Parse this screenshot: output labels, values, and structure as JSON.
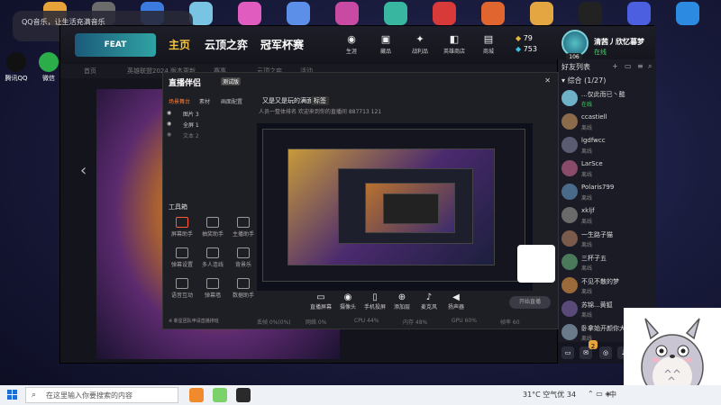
{
  "toast": {
    "text": "QQ音乐，让生活充满音乐"
  },
  "desktop": {
    "icons": [
      {
        "label": "腾讯QQ",
        "color": "#1a1a1a"
      },
      {
        "label": "微信",
        "color": "#2bae4a"
      }
    ]
  },
  "client": {
    "brand": "FEAT",
    "nav": [
      "主页",
      "云顶之弈",
      "冠军杯赛"
    ],
    "top_icons": [
      {
        "label": "生涯",
        "icon": "person-icon"
      },
      {
        "label": "藏品",
        "icon": "collection-icon"
      },
      {
        "label": "战利品",
        "icon": "loot-icon"
      },
      {
        "label": "英雄商店",
        "icon": "store-icon"
      },
      {
        "label": "商城",
        "icon": "shop-icon"
      }
    ],
    "currency": {
      "be": "79",
      "rp": "753"
    },
    "profile": {
      "name": "清茜丿欣忆暮梦",
      "status": "在线",
      "level": "106"
    },
    "subnav": [
      "首页",
      "英雄联盟2024",
      "版本更新",
      "赛事",
      "云顶之弈",
      "活动"
    ],
    "hero_glyph": "光",
    "accent": "#f5c542"
  },
  "friends": {
    "title": "好友列表",
    "group": "综合 (1/27)",
    "list": [
      {
        "name": "...仅此而已丶懿",
        "status": "在线",
        "online": true
      },
      {
        "name": "ccastiell",
        "status": "离线",
        "online": false
      },
      {
        "name": "lgdfwcc",
        "status": "离线",
        "online": false
      },
      {
        "name": "LarSce",
        "status": "离线",
        "online": false
      },
      {
        "name": "Polaris799",
        "status": "离线",
        "online": false
      },
      {
        "name": "xkljf",
        "status": "离线",
        "online": false
      },
      {
        "name": "一生路子猫",
        "status": "离线",
        "online": false
      },
      {
        "name": "三杯子五",
        "status": "离线",
        "online": false
      },
      {
        "name": "不见不散的梦",
        "status": "离线",
        "online": false
      },
      {
        "name": "苏锦...黄狐",
        "status": "离线",
        "online": false
      },
      {
        "name": "卧拿始开颜你大",
        "status": "离线",
        "online": false
      }
    ],
    "footer_badge": "2"
  },
  "stream": {
    "title": "直播伴侣",
    "version": "测试版",
    "tabs": [
      "场景舞台",
      "素材",
      "画面配置"
    ],
    "scenes": [
      {
        "label": "图片 3"
      },
      {
        "label": "全屏 1"
      },
      {
        "label": "文本 2"
      }
    ],
    "room_title": "又是又是玩的满面",
    "room_tag": "标签",
    "room_sub": "人员一整体排名   欢迎来到你的直播间   887713   121",
    "tools_title": "工具箱",
    "tools": [
      {
        "label": "屏幕助手",
        "highlight": true
      },
      {
        "label": "抽奖助手",
        "highlight": false
      },
      {
        "label": "主播助手",
        "highlight": false
      },
      {
        "label": "弹幕设置",
        "highlight": false
      },
      {
        "label": "多人连线",
        "highlight": false
      },
      {
        "label": "背景乐",
        "highlight": false
      },
      {
        "label": "语音互动",
        "highlight": false
      },
      {
        "label": "弹幕墙",
        "highlight": false
      },
      {
        "label": "数据助手",
        "highlight": false
      }
    ],
    "tools_note": "※ 新星团队申请直播排班",
    "controls": [
      {
        "label": "直播屏幕",
        "icon": "screen-icon"
      },
      {
        "label": "摄像头",
        "icon": "camera-icon"
      },
      {
        "label": "手机投屏",
        "icon": "phone-cast-icon"
      },
      {
        "label": "添加层",
        "icon": "layer-icon"
      },
      {
        "label": "麦克风",
        "icon": "mic-icon"
      },
      {
        "label": "扬声器",
        "icon": "speaker-icon"
      }
    ],
    "go_live": "开始直播",
    "status": [
      "丢帧 0%(0%)",
      "网络 0%",
      "CPU 44%",
      "内存 48%",
      "GPU 60%",
      "帧率 60"
    ]
  },
  "taskbar": {
    "search_placeholder": "在这里输入你要搜索的内容",
    "weather": "31°C  空气优 34",
    "lang": "中"
  }
}
